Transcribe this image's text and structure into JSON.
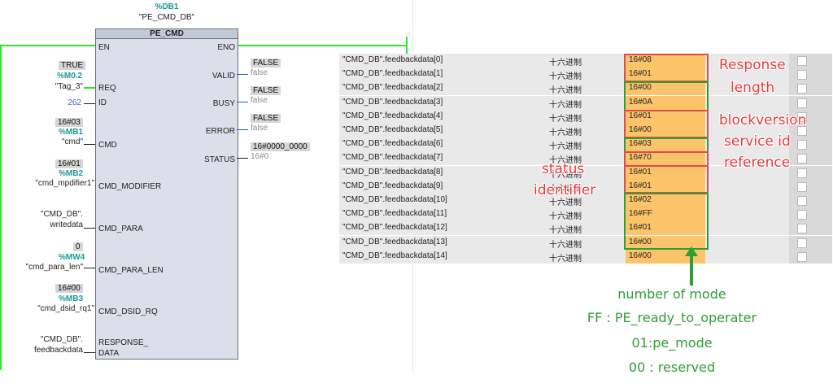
{
  "block": {
    "db_address": "%DB1",
    "db_name": "\"PE_CMD_DB\"",
    "title": "PE_CMD",
    "pins_in": [
      "EN",
      "REQ",
      "ID",
      "CMD",
      "CMD_MODIFIER",
      "CMD_PARA",
      "CMD_PARA_LEN",
      "CMD_DSID_RQ",
      "RESPONSE_",
      "DATA"
    ],
    "pins_out": [
      "ENO",
      "VALID",
      "BUSY",
      "ERROR",
      "STATUS"
    ]
  },
  "inputs": {
    "req_value": "TRUE",
    "req_addr": "%M0.2",
    "req_tag": "\"Tag_3\"",
    "id_value": "262",
    "cmd_value": "16#03",
    "cmd_addr": "%MB1",
    "cmd_tag": "\"cmd\"",
    "mod_value": "16#01",
    "mod_addr": "%MB2",
    "mod_tag": "\"cmd_mpdifier1\"",
    "para_tag1": "\"CMD_DB\".",
    "para_tag2": "writedata",
    "len_value": "0",
    "len_addr": "%MW4",
    "len_tag": "\"cmd_para_len\"",
    "dsid_value": "16#00",
    "dsid_addr": "%MB3",
    "dsid_tag": "\"cmd_dsid_rq1\"",
    "resp_tag1": "\"CMD_DB\".",
    "resp_tag2": "feedbackdata"
  },
  "outputs": {
    "valid_value": "FALSE",
    "valid_sub": "false",
    "busy_value": "FALSE",
    "busy_sub": "false",
    "error_value": "FALSE",
    "error_sub": "false",
    "status_value": "16#0000_0000",
    "status_sub": "16#0"
  },
  "table": {
    "rows": [
      {
        "name": "\"CMD_DB\".feedbackdata[0]",
        "format": "十六进制",
        "value": "16#08"
      },
      {
        "name": "\"CMD_DB\".feedbackdata[1]",
        "format": "十六进制",
        "value": "16#01"
      },
      {
        "name": "\"CMD_DB\".feedbackdata[2]",
        "format": "十六进制",
        "value": "16#00"
      },
      {
        "name": "\"CMD_DB\".feedbackdata[3]",
        "format": "十六进制",
        "value": "16#0A"
      },
      {
        "name": "\"CMD_DB\".feedbackdata[4]",
        "format": "十六进制",
        "value": "16#01"
      },
      {
        "name": "\"CMD_DB\".feedbackdata[5]",
        "format": "十六进制",
        "value": "16#00"
      },
      {
        "name": "\"CMD_DB\".feedbackdata[6]",
        "format": "十六进制",
        "value": "16#03"
      },
      {
        "name": "\"CMD_DB\".feedbackdata[7]",
        "format": "十六进制",
        "value": "16#70"
      },
      {
        "name": "\"CMD_DB\".feedbackdata[8]",
        "format": "十六进制",
        "value": "16#01"
      },
      {
        "name": "\"CMD_DB\".feedbackdata[9]",
        "format": "十六进制",
        "value": "16#01"
      },
      {
        "name": "\"CMD_DB\".feedbackdata[10]",
        "format": "十六进制",
        "value": "16#02"
      },
      {
        "name": "\"CMD_DB\".feedbackdata[11]",
        "format": "十六进制",
        "value": "16#FF"
      },
      {
        "name": "\"CMD_DB\".feedbackdata[12]",
        "format": "十六进制",
        "value": "16#01"
      },
      {
        "name": "\"CMD_DB\".feedbackdata[13]",
        "format": "十六进制",
        "value": "16#00"
      },
      {
        "name": "\"CMD_DB\".feedbackdata[14]",
        "format": "十六进制",
        "value": "16#00"
      }
    ]
  },
  "annotations": {
    "response": "Response",
    "length": "length",
    "blockversion": "blockversion",
    "service_id": "service id",
    "reference": "reference",
    "status": "status",
    "identifier": "identifier",
    "mode_line1": "number of mode",
    "mode_line2": "FF : PE_ready_to_operater",
    "mode_line3": "01:pe_mode",
    "mode_line4": "00 : reserved"
  },
  "colors": {
    "power_rail": "#2ee62e",
    "value_highlight": "#fcc46a",
    "annotation_red": "#e53a3a",
    "annotation_green": "#2f9e35"
  }
}
